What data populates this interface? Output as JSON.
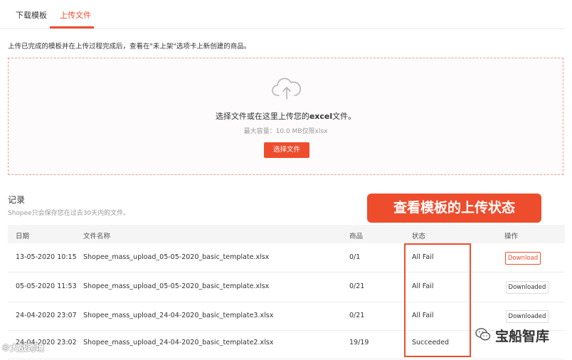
{
  "tabs": [
    {
      "label": "下载模板",
      "active": false
    },
    {
      "label": "上传文件",
      "active": true
    }
  ],
  "info_text": "上传已完成的模板并在上传过程完成后，查看在\"未上架\"选项卡上新创建的商品。",
  "dropzone": {
    "main_pre": "选择文件或在这里上传您的",
    "main_bold": "excel",
    "main_post": "文件。",
    "sub": "最大容量：10.0 MB仅限xlsx",
    "button": "选择文件"
  },
  "records": {
    "title": "记录",
    "subtitle": "Shopee只会保存您在过去30天内的文件。"
  },
  "callout": "查看模板的上传状态",
  "table": {
    "headers": {
      "date": "日期",
      "filename": "文件名称",
      "products": "商品",
      "status": "状态",
      "action": "操作"
    },
    "rows": [
      {
        "date": "13-05-2020 10:15",
        "filename": "Shopee_mass_upload_05-05-2020_basic_template.xlsx",
        "products": "0/1",
        "status": "All Fail",
        "action": "Download"
      },
      {
        "date": "05-05-2020 11:53",
        "filename": "Shopee_mass_upload_05-05-2020_basic_template.xlsx",
        "products": "0/21",
        "status": "All Fail",
        "action": "Downloaded"
      },
      {
        "date": "24-04-2020 23:07",
        "filename": "Shopee_mass_upload_24-04-2020_basic_template3.xlsx",
        "products": "0/21",
        "status": "All Fail",
        "action": "Downloaded"
      },
      {
        "date": "24-04-2020 23:02",
        "filename": "Shopee_mass_upload_24-04-2020_basic_template2.xlsx",
        "products": "19/19",
        "status": "Succeeded",
        "action": ""
      }
    ]
  },
  "watermarks": {
    "right": "宝船智库",
    "left": "©大战跨境"
  },
  "colors": {
    "accent": "#ee4d2d",
    "header_bg": "#f5f5f5"
  }
}
